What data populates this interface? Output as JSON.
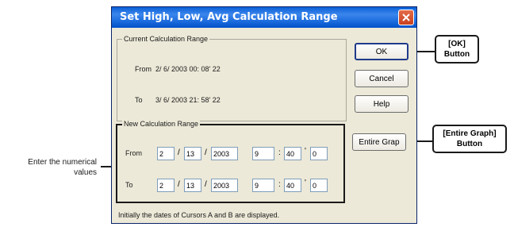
{
  "dialog": {
    "title": "Set High, Low, Avg Calculation Range",
    "current_group": {
      "legend": "Current Calculation Range",
      "from_label": "From",
      "from_value": "2/ 6/ 2003  00: 08' 22",
      "to_label": "To",
      "to_value": "3/ 6/ 2003  21: 58' 22"
    },
    "new_group": {
      "legend": "New Calculation Range",
      "from_label": "From",
      "to_label": "To",
      "from": {
        "month": "2",
        "day": "13",
        "year": "2003",
        "hour": "9",
        "minute": "40",
        "second": "0"
      },
      "to": {
        "month": "2",
        "day": "13",
        "year": "2003",
        "hour": "9",
        "minute": "40",
        "second": "0"
      },
      "date_sep": "/",
      "time_sep1": ":",
      "time_sep2": "'"
    },
    "buttons": {
      "ok": "OK",
      "cancel": "Cancel",
      "help": "Help",
      "entire_graph": "Entire Grap"
    },
    "footer": "Initially the dates of Cursors A and B are displayed."
  },
  "annotations": {
    "ok_callout": [
      "[OK]",
      "Button"
    ],
    "entire_graph_callout": [
      "[Entire Graph]",
      "Button"
    ],
    "left_note": [
      "Enter the numerical",
      "values"
    ]
  },
  "icons": [
    "close-icon"
  ],
  "colors": {
    "title_bar": "#0a5fd8",
    "dialog_bg": "#ece9d8",
    "close_button": "#d4502c",
    "field_border": "#7f9db9"
  }
}
